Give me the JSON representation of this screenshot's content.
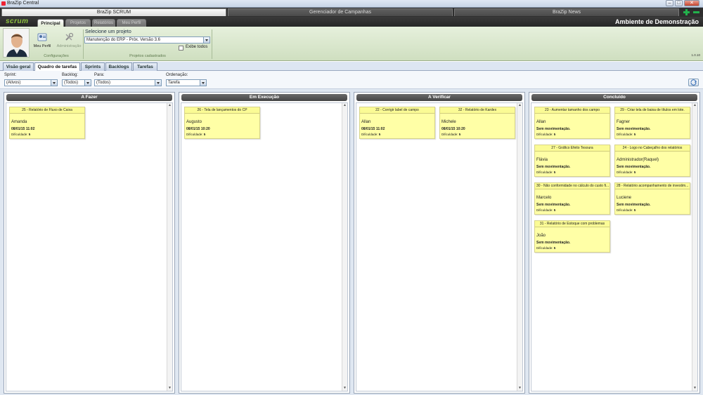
{
  "window": {
    "title": "BraZip Central"
  },
  "app_tabs": [
    "BraZip SCRUM",
    "Gerenciador de Campanhas",
    "BraZip News"
  ],
  "header": {
    "logo": "scrum",
    "nav_tabs": [
      "Principal",
      "Projetos",
      "Relatórios",
      "Meu Perfil"
    ],
    "env_title": "Ambiente de Demonstração"
  },
  "ribbon": {
    "btn_profile": "Meu Perfil",
    "btn_admin": "Administração",
    "group_config": "Configurações",
    "project_label": "Selecione um projeto",
    "project_selected": "Manutenção do ERP - Próx. Versão 3.6",
    "show_all_label": "Exibe todos",
    "group_projects": "Projetos cadastrados",
    "version": "1.0.10"
  },
  "view_tabs": [
    "Visão geral",
    "Quadro de tarefas",
    "Sprints",
    "Backlogs",
    "Tarefas"
  ],
  "filters": {
    "sprint_label": "Sprint:",
    "sprint_value": "(Ativos)",
    "backlog_label": "Backlog:",
    "backlog_value": "(Todos)",
    "para_label": "Para:",
    "para_value": "(Todos)",
    "ordem_label": "Ordenação:",
    "ordem_value": "Tarefa"
  },
  "difficulty_label": "Dificuldade:",
  "columns": [
    {
      "title": "A Fazer",
      "cards": [
        {
          "title": "25 - Relatório de Fluxo de Caixa",
          "user": "Amanda",
          "date": "08/01/15 11:02",
          "difficulty": "5"
        }
      ]
    },
    {
      "title": "Em Execução",
      "cards": [
        {
          "title": "26 - Tela de lançamentos do CP",
          "user": "Augusto",
          "date": "08/01/15 10:20",
          "difficulty": "5"
        }
      ]
    },
    {
      "title": "A Verificar",
      "cards": [
        {
          "title": "22 - Corrigir label de campo",
          "user": "Allan",
          "date": "08/01/15 11:02",
          "difficulty": "5"
        },
        {
          "title": "32 - Relatório de Kardex",
          "user": "Michele",
          "date": "08/01/15 10:20",
          "difficulty": "5"
        }
      ]
    },
    {
      "title": "Concluído",
      "cards": [
        {
          "title": "23 - Aumentar tamanho dos campo",
          "user": "Allan",
          "date": "Sem movimentação.",
          "difficulty": "5"
        },
        {
          "title": "29 - Criar tela de baixa de títulos em lote.",
          "user": "Fagner",
          "date": "Sem movimentação.",
          "difficulty": "5"
        },
        {
          "title": "27 - Gráfico Efeito Tesoura",
          "user": "Flávia",
          "date": "Sem movimentação.",
          "difficulty": "5"
        },
        {
          "title": "24 - Logo no Cabeçalho dos relatórios",
          "user": "Administrador(Raquel)",
          "date": "Sem movimentação.",
          "difficulty": "5"
        },
        {
          "title": "30 - Não conformidade no cálculo do custo fi...",
          "user": "Marcelo",
          "date": "Sem movimentação.",
          "difficulty": "5"
        },
        {
          "title": "28 - Relatório acompanhamento de investim...",
          "user": "Luciene",
          "date": "Sem movimentação.",
          "difficulty": "5"
        },
        {
          "title": "31 - Relatório de Estoque com problemas",
          "user": "João",
          "date": "Sem movimentação.",
          "difficulty": "5"
        }
      ]
    }
  ]
}
